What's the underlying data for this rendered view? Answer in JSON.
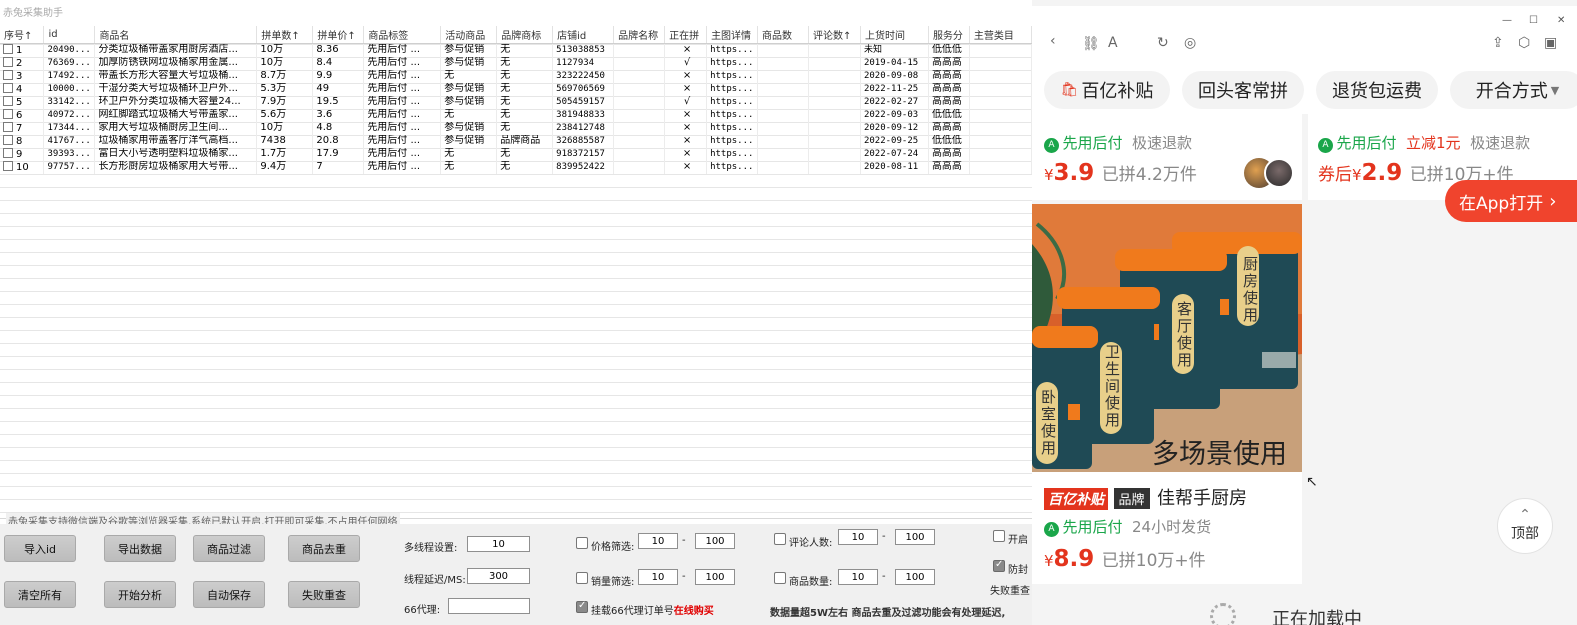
{
  "app": {
    "title": "赤兔采集助手"
  },
  "table": {
    "headers": [
      "序号↑",
      "id",
      "商品名",
      "拼单数↑",
      "拼单价↑",
      "商品标签",
      "活动商品",
      "品牌商标",
      "店铺id",
      "品牌名称",
      "正在拼",
      "主图详情",
      "商品数",
      "评论数↑",
      "上货时间",
      "服务分",
      "主营类目"
    ],
    "rows": [
      [
        "1",
        "20490...",
        "分类垃圾桶带盖家用厨房酒店...",
        "10万",
        "8.36",
        "先用后付 ...",
        "参与促销",
        "无",
        "513038853",
        "",
        "×",
        "https...",
        "",
        "",
        "未知",
        "低低低"
      ],
      [
        "2",
        "76369...",
        "加厚防锈铁网垃圾桶家用金属...",
        "10万",
        "8.4",
        "先用后付 ...",
        "参与促销",
        "无",
        "1127934",
        "",
        "√",
        "https...",
        "",
        "",
        "2019-04-15",
        "高高高"
      ],
      [
        "3",
        "17492...",
        "带盖长方形大容量大号垃圾桶...",
        "8.7万",
        "9.9",
        "先用后付 ...",
        "无",
        "无",
        "323222450",
        "",
        "×",
        "https...",
        "",
        "",
        "2020-09-08",
        "高高高"
      ],
      [
        "4",
        "10000...",
        "干湿分类大号垃圾桶环卫户外...",
        "5.3万",
        "49",
        "先用后付 ...",
        "参与促销",
        "无",
        "569706569",
        "",
        "×",
        "https...",
        "",
        "",
        "2022-11-25",
        "高高高"
      ],
      [
        "5",
        "33142...",
        "环卫户外分类垃圾桶大容量24...",
        "7.9万",
        "19.5",
        "先用后付 ...",
        "参与促销",
        "无",
        "505459157",
        "",
        "√",
        "https...",
        "",
        "",
        "2022-02-27",
        "高高高"
      ],
      [
        "6",
        "40972...",
        "网红脚踏式垃圾桶大号带盖家...",
        "5.6万",
        "3.6",
        "先用后付 ...",
        "无",
        "无",
        "381948833",
        "",
        "×",
        "https...",
        "",
        "",
        "2022-09-03",
        "低低低"
      ],
      [
        "7",
        "17344...",
        "家用大号垃圾桶厨房卫生间...",
        "10万",
        "4.8",
        "先用后付 ...",
        "参与促销",
        "无",
        "238412748",
        "",
        "×",
        "https...",
        "",
        "",
        "2020-09-12",
        "高高高"
      ],
      [
        "8",
        "41767...",
        "垃圾桶家用带盖客厅洋气高档...",
        "7438",
        "20.8",
        "先用后付 ...",
        "参与促销",
        "品牌商品",
        "326885587",
        "",
        "×",
        "https...",
        "",
        "",
        "2022-09-25",
        "低低低"
      ],
      [
        "9",
        "39393...",
        "富日大小号透明塑料垃圾桶家...",
        "1.7万",
        "17.9",
        "先用后付 ...",
        "无",
        "无",
        "918372157",
        "",
        "×",
        "https...",
        "",
        "",
        "2022-07-24",
        "高高高"
      ],
      [
        "10",
        "97757...",
        "长方形厨房垃圾桶家用大号带...",
        "9.4万",
        "7",
        "先用后付 ...",
        "无",
        "无",
        "839952422",
        "",
        "×",
        "https...",
        "",
        "",
        "2020-08-11",
        "高高高"
      ]
    ]
  },
  "notice": "赤兔采集支持微信端及谷歌等浏览器采集,系统已默认开启,打开即可采集,不占用任何网络",
  "buttons": {
    "import_id": "导入id",
    "export": "导出数据",
    "filter": "商品过滤",
    "dedupe": "商品去重",
    "clear": "清空所有",
    "analyze": "开始分析",
    "autosave": "自动保存",
    "retry": "失败重查"
  },
  "settings": {
    "threads_label": "多线程设置:",
    "threads_value": "10",
    "delay_label": "线程延迟/MS:",
    "delay_value": "300",
    "proxy_label": "66代理:",
    "proxy_value": "",
    "price_filter_label": "价格筛选:",
    "price_min": "10",
    "price_max": "100",
    "sales_filter_label": "销量筛选:",
    "sales_min": "10",
    "sales_max": "100",
    "hang_label": "挂载66代理订单号",
    "hang_link": "在线购买",
    "review_label": "评论人数:",
    "review_min": "10",
    "review_max": "100",
    "count_label": "商品数量:",
    "count_min": "10",
    "count_max": "100",
    "range_sep": "-",
    "info": "数据量超5W左右 商品去重及过滤功能会有处理延迟,",
    "open_label": "开启",
    "anti_label": "防封",
    "retry_label": "失败重查"
  },
  "browser": {
    "chips": [
      "百亿补贴",
      "回头客常拼",
      "退货包运费",
      "开合方式"
    ],
    "card1": {
      "tag1": "先用后付",
      "tag2": "极速退款",
      "currency": "¥",
      "price": "3.9",
      "sold": "已拼4.2万件"
    },
    "card2": {
      "tag1": "先用后付",
      "tag2": "立减1元",
      "tag3": "极速退款",
      "prefix": "券后",
      "currency": "¥",
      "price": "2.9",
      "sold": "已拼10万+件"
    },
    "app_button": "在App打开",
    "image_labels": [
      "卧室使用",
      "卫生间使用",
      "客厅使用",
      "厨房使用"
    ],
    "image_caption": "多场景使用",
    "card3": {
      "badge1": "百亿补贴",
      "badge2": "品牌",
      "shop": "佳帮手厨房",
      "tag1": "先用后付",
      "tag2": "24小时发货",
      "currency": "¥",
      "price": "8.9",
      "sold": "已拼10万+件"
    },
    "top_button": "顶部",
    "loading": "正在加载中"
  },
  "colors": {
    "accent_red": "#e3341d",
    "green": "#1aa64a",
    "orange_lid": "#f07a1c",
    "bin_teal": "#1f4a55"
  }
}
